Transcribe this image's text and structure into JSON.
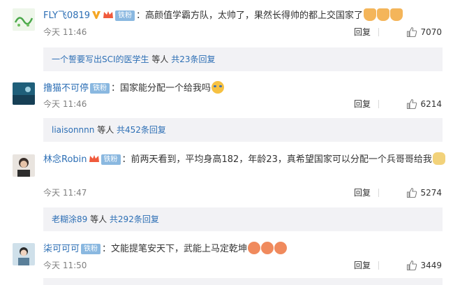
{
  "colors": {
    "username": "#eb7350",
    "link": "#2d6fb5",
    "badge": "#8ab8e0",
    "muted": "#808080",
    "reply_bg": "#f2f2f5"
  },
  "comments": [
    {
      "username": "FLY飞0819",
      "badge": "铁粉",
      "text": "：高颜值学霸方队，太帅了，果然长得帅的都上交国家了",
      "time": "今天 11:46",
      "reply_label": "回复",
      "likes": "7070",
      "replies": {
        "user": "一个誓要写出SCI的医学生",
        "middle": " 等人 ",
        "count": "共23条回复"
      }
    },
    {
      "username": "撸猫不可停",
      "badge": "铁粉",
      "text": "：国家能分配一个给我吗",
      "time": "今天 11:46",
      "reply_label": "回复",
      "likes": "6214",
      "replies": {
        "user": "liaisonnnn",
        "middle": " 等人 ",
        "count": "共452条回复"
      }
    },
    {
      "username": "林念Robin",
      "badge": "铁粉",
      "text": "：前两天看到，平均身高182，年龄23，真希望国家可以分配一个兵哥哥给我",
      "time": "今天 11:47",
      "reply_label": "回复",
      "likes": "5274",
      "replies": {
        "user": "老糊涂89",
        "middle": " 等人 ",
        "count": "共292条回复"
      }
    },
    {
      "username": "柒可可可",
      "badge": "铁粉",
      "text": "：文能提笔安天下，武能上马定乾坤",
      "time": "今天 11:50",
      "reply_label": "回复",
      "likes": "3449"
    }
  ]
}
